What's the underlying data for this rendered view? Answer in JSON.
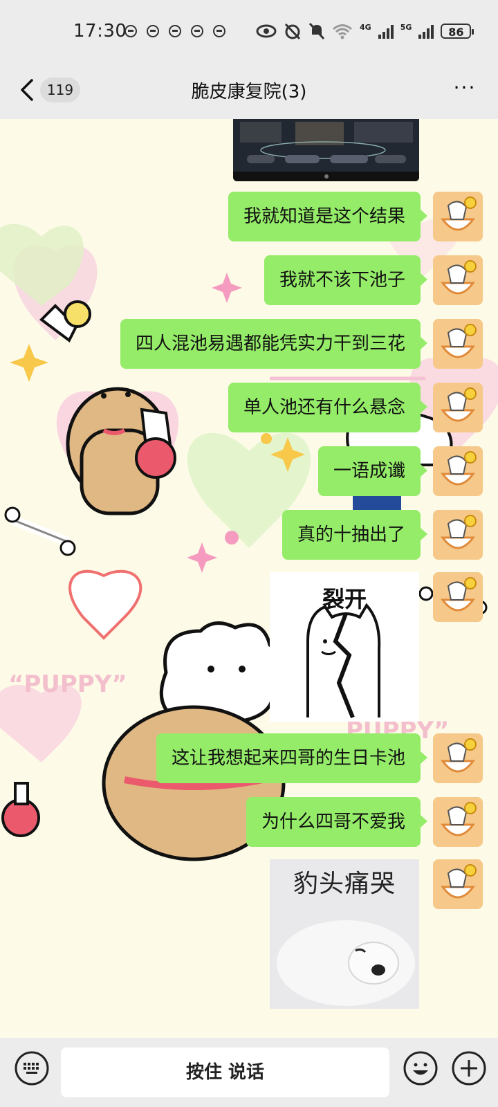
{
  "status_bar": {
    "time": "17:30",
    "signal_1": "4G",
    "signal_2": "5G",
    "battery": "86"
  },
  "header": {
    "unread_count": "119",
    "title": "脆皮康复院(3)",
    "more_label": "···"
  },
  "messages": [
    {
      "type": "image",
      "description_icon": "game-screenshot"
    },
    {
      "type": "text",
      "text": "我就知道是这个结果"
    },
    {
      "type": "text",
      "text": "我就不该下池子"
    },
    {
      "type": "text",
      "text": "四人混池易遇都能凭实力干到三花"
    },
    {
      "type": "text",
      "text": "单人池还有什么悬念"
    },
    {
      "type": "text",
      "text": "一语成谶"
    },
    {
      "type": "text",
      "text": "真的十抽出了"
    },
    {
      "type": "sticker",
      "text": "裂开"
    },
    {
      "type": "text",
      "text": "这让我想起来四哥的生日卡池"
    },
    {
      "type": "text",
      "text": "为什么四哥不爱我"
    },
    {
      "type": "sticker",
      "text": "豹头痛哭"
    }
  ],
  "wallpaper": {
    "text_1": "“PUPPY”",
    "text_2": "PUPPY”"
  },
  "bottom_bar": {
    "hold_to_talk": "按住 说话"
  },
  "colors": {
    "bubble": "#95ec69",
    "chat_background": "#fdfbe8",
    "bar_background": "#ececec"
  }
}
